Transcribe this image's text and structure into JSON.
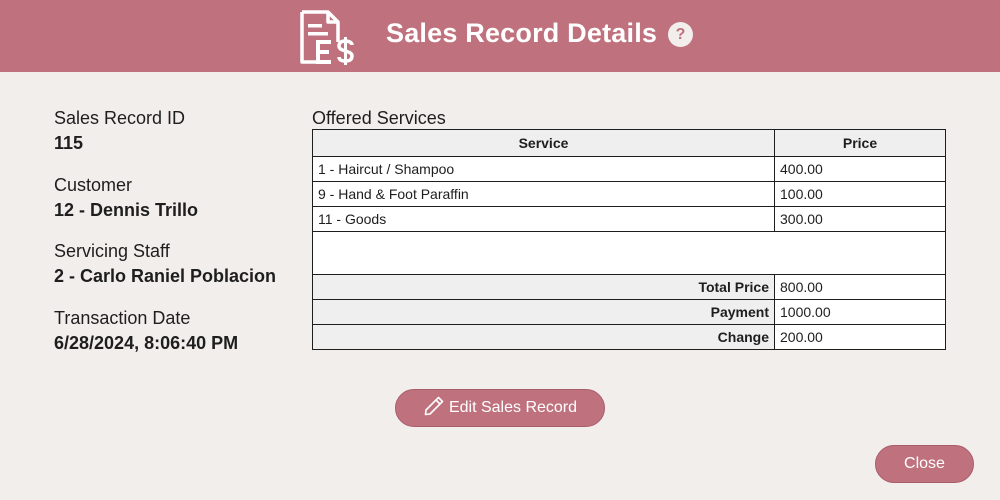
{
  "header": {
    "title": "Sales Record Details",
    "icon": "sales-receipt-dollar-icon",
    "help_label": "?"
  },
  "fields": {
    "sales_record_id": {
      "label": "Sales Record ID",
      "value": "115"
    },
    "customer": {
      "label": "Customer",
      "value": "12 - Dennis Trillo"
    },
    "servicing_staff": {
      "label": "Servicing Staff",
      "value": "2 - Carlo Raniel Poblacion"
    },
    "transaction_date": {
      "label": "Transaction Date",
      "value": "6/28/2024, 8:06:40 PM"
    }
  },
  "services": {
    "title": "Offered Services",
    "columns": [
      "Service",
      "Price"
    ],
    "rows": [
      {
        "service": "1 - Haircut / Shampoo",
        "price": "400.00"
      },
      {
        "service": "9 - Hand & Foot Paraffin",
        "price": "100.00"
      },
      {
        "service": "11 - Goods",
        "price": "300.00"
      }
    ],
    "summary": [
      {
        "label": "Total Price",
        "value": "800.00"
      },
      {
        "label": "Payment",
        "value": "1000.00"
      },
      {
        "label": "Change",
        "value": "200.00"
      }
    ]
  },
  "buttons": {
    "edit_label": "Edit Sales Record",
    "edit_icon": "pencil-icon",
    "close_label": "Close"
  },
  "colors": {
    "accent": "#bf727e",
    "background": "#f2eeec",
    "table_header": "#efefef"
  }
}
